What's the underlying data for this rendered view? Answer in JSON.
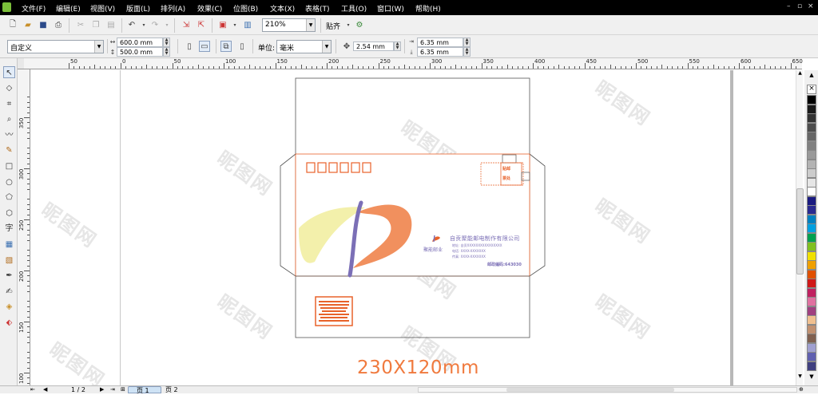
{
  "menu": [
    "文件(F)",
    "编辑(E)",
    "视图(V)",
    "版面(L)",
    "排列(A)",
    "效果(C)",
    "位图(B)",
    "文本(X)",
    "表格(T)",
    "工具(O)",
    "窗口(W)",
    "帮助(H)"
  ],
  "toolbar": {
    "zoom_value": "210%",
    "snap_label": "贴齐"
  },
  "property_bar": {
    "page_preset": "自定义",
    "page_width": "600.0 mm",
    "page_height": "500.0 mm",
    "units_label": "单位:",
    "units_value": "毫米",
    "nudge": "2.54 mm",
    "dup_x": "6.35 mm",
    "dup_y": "6.35 mm"
  },
  "ruler": {
    "h_labels": [
      "50",
      "0",
      "50",
      "100",
      "150",
      "200",
      "250",
      "300",
      "350",
      "400",
      "450",
      "500",
      "550",
      "600",
      "650"
    ],
    "v_labels": [
      "350",
      "300",
      "250",
      "200",
      "150",
      "100"
    ]
  },
  "toolbox": {
    "text_tool_glyph": "字"
  },
  "envelope": {
    "company_name": "自贡聚能邮电制作有限公司",
    "brand": "聚能邮业",
    "address_line": "地址: 自贡XXXXXXXXXXXXXXXX",
    "phone_line": "电话: XXXX-XXXXXXX",
    "fax_line": "传真: XXXX-XXXXXXX",
    "postcode": "邮政编码:643030",
    "stamp_top": "贴邮",
    "stamp_bottom": "票处",
    "red_stamp_lines": [
      "XXXXXXXX",
      "XXXXXXXXXX",
      "XXXXXXXXX",
      "XXXXXXXX",
      "XXXXXXX",
      "XXXXXXXXX",
      "XXXXXXXX"
    ]
  },
  "dimension_caption": "230X120mm",
  "watermark": "昵图网",
  "status": {
    "page_counter": "1 / 2",
    "tab1": "页 1",
    "tab2": "页 2"
  },
  "colors": {
    "accent_orange": "#e8622a",
    "caption_orange": "#f07a3e",
    "swoosh_purple": "#7b6fb6",
    "swoosh_yellow": "#f1ed9c"
  }
}
